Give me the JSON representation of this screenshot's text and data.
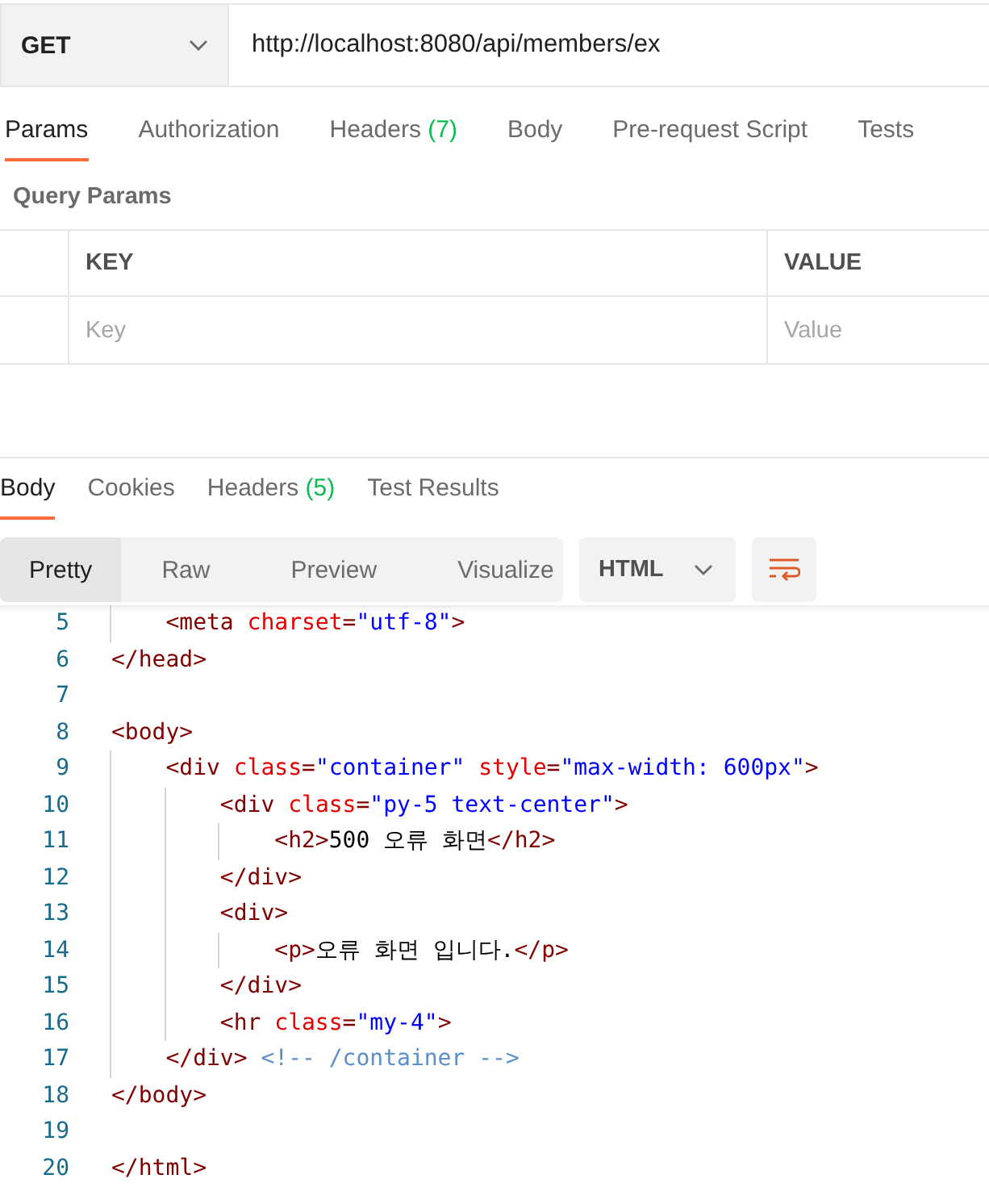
{
  "request": {
    "method": "GET",
    "url": "http://localhost:8080/api/members/ex"
  },
  "request_tabs": [
    {
      "label": "Params",
      "selected": true
    },
    {
      "label": "Authorization",
      "selected": false
    },
    {
      "label": "Headers",
      "count": "(7)",
      "selected": false
    },
    {
      "label": "Body",
      "selected": false
    },
    {
      "label": "Pre-request Script",
      "selected": false
    },
    {
      "label": "Tests",
      "selected": false
    }
  ],
  "query_params": {
    "title": "Query Params",
    "columns": [
      "KEY",
      "VALUE"
    ],
    "row": {
      "key_placeholder": "Key",
      "value_placeholder": "Value"
    }
  },
  "response_tabs": [
    {
      "label": "Body",
      "selected": true
    },
    {
      "label": "Cookies",
      "selected": false
    },
    {
      "label": "Headers",
      "count": "(5)",
      "selected": false
    },
    {
      "label": "Test Results",
      "selected": false
    }
  ],
  "view_modes": [
    {
      "label": "Pretty",
      "selected": true
    },
    {
      "label": "Raw",
      "selected": false
    },
    {
      "label": "Preview",
      "selected": false
    },
    {
      "label": "Visualize",
      "selected": false
    }
  ],
  "format": "HTML",
  "code_lines": [
    {
      "number": "5",
      "tokens": [
        {
          "kind": "tag",
          "text": "    <meta"
        },
        {
          "kind": "attr",
          "text": " charset"
        },
        {
          "kind": "tag",
          "text": "="
        },
        {
          "kind": "str",
          "text": "\"utf-8\""
        },
        {
          "kind": "tag",
          "text": ">"
        }
      ]
    },
    {
      "number": "6",
      "tokens": [
        {
          "kind": "tag",
          "text": "</head>"
        }
      ]
    },
    {
      "number": "7"
    },
    {
      "number": "8",
      "tokens": [
        {
          "kind": "tag",
          "text": "<body>"
        }
      ]
    },
    {
      "number": "9",
      "tokens": [
        {
          "kind": "tag",
          "text": "    <div"
        },
        {
          "kind": "attr",
          "text": " class"
        },
        {
          "kind": "tag",
          "text": "="
        },
        {
          "kind": "str",
          "text": "\"container\""
        },
        {
          "kind": "attr",
          "text": " style"
        },
        {
          "kind": "tag",
          "text": "="
        },
        {
          "kind": "str",
          "text": "\"max-width: 600px\""
        },
        {
          "kind": "tag",
          "text": ">"
        }
      ]
    },
    {
      "number": "10",
      "tokens": [
        {
          "kind": "tag",
          "text": "        <div"
        },
        {
          "kind": "attr",
          "text": " class"
        },
        {
          "kind": "tag",
          "text": "="
        },
        {
          "kind": "str",
          "text": "\"py-5 text-center\""
        },
        {
          "kind": "tag",
          "text": ">"
        }
      ]
    },
    {
      "number": "11",
      "tokens": [
        {
          "kind": "tag",
          "text": "            <h2>"
        },
        {
          "kind": "text",
          "text": "500 오류 화면"
        },
        {
          "kind": "tag",
          "text": "</h2>"
        }
      ]
    },
    {
      "number": "12",
      "tokens": [
        {
          "kind": "tag",
          "text": "        </div>"
        }
      ]
    },
    {
      "number": "13",
      "tokens": [
        {
          "kind": "tag",
          "text": "        <div>"
        }
      ]
    },
    {
      "number": "14",
      "tokens": [
        {
          "kind": "tag",
          "text": "            <p>"
        },
        {
          "kind": "text",
          "text": "오류 화면 입니다."
        },
        {
          "kind": "tag",
          "text": "</p>"
        }
      ]
    },
    {
      "number": "15",
      "tokens": [
        {
          "kind": "tag",
          "text": "        </div>"
        }
      ]
    },
    {
      "number": "16",
      "tokens": [
        {
          "kind": "tag",
          "text": "        <hr"
        },
        {
          "kind": "attr",
          "text": " class"
        },
        {
          "kind": "tag",
          "text": "="
        },
        {
          "kind": "str",
          "text": "\"my-4\""
        },
        {
          "kind": "tag",
          "text": ">"
        }
      ]
    },
    {
      "number": "17",
      "tokens": [
        {
          "kind": "tag",
          "text": "    </div>"
        },
        {
          "kind": "comment",
          "text": " <!-- /container -->"
        }
      ]
    },
    {
      "number": "18",
      "tokens": [
        {
          "kind": "tag",
          "text": "</body>"
        }
      ]
    },
    {
      "number": "19"
    },
    {
      "number": "20",
      "tokens": [
        {
          "kind": "tag",
          "text": "</html>"
        }
      ]
    }
  ]
}
